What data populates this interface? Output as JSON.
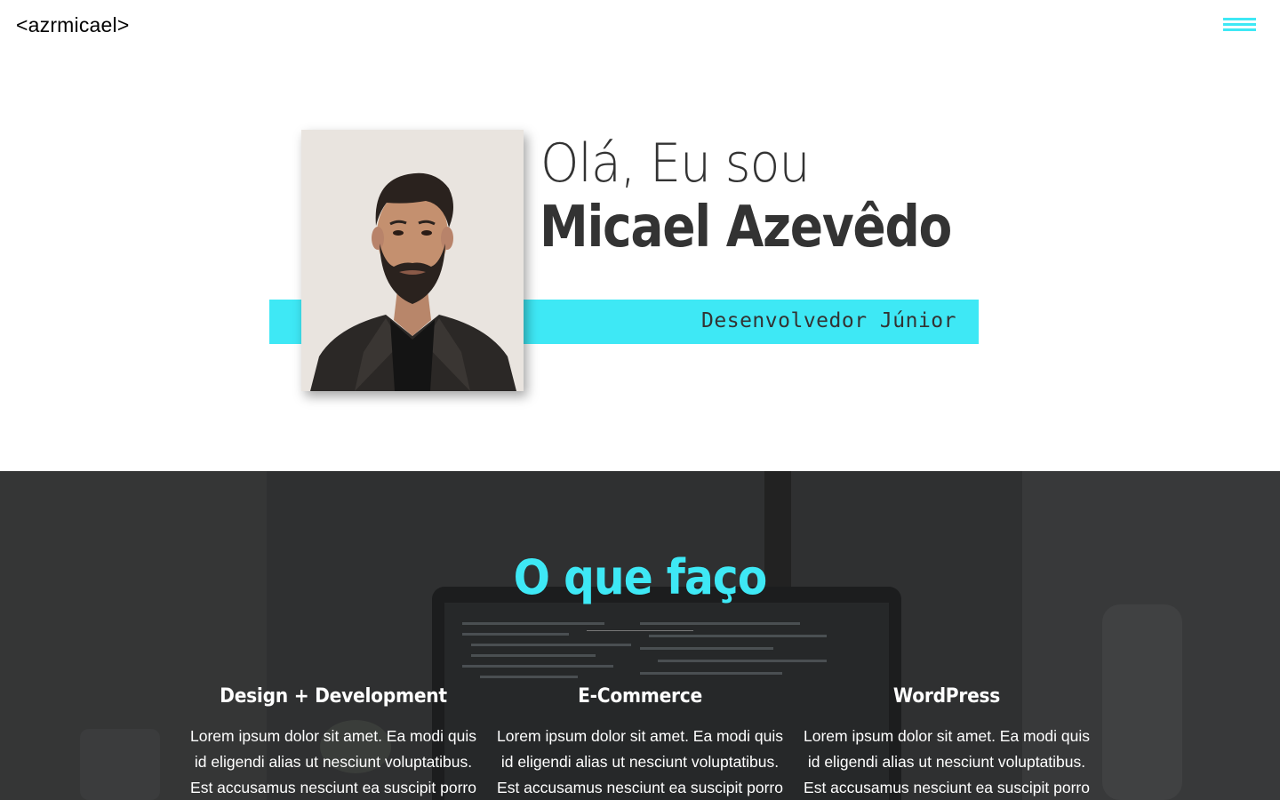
{
  "header": {
    "logo": "<azrmicael>",
    "menu_icon": "hamburger-menu-icon"
  },
  "hero": {
    "greeting": "Olá, Eu sou",
    "name": "Micael Azevêdo",
    "role": "Desenvolvedor Júnior"
  },
  "services": {
    "title": "O que faço",
    "items": [
      {
        "title": "Design + Development",
        "text": "Lorem ipsum dolor sit amet. Ea modi quis id eligendi alias ut nesciunt voluptatibus. Est accusamus nesciunt ea suscipit porro"
      },
      {
        "title": "E-Commerce",
        "text": "Lorem ipsum dolor sit amet. Ea modi quis id eligendi alias ut nesciunt voluptatibus. Est accusamus nesciunt ea suscipit porro"
      },
      {
        "title": "WordPress",
        "text": "Lorem ipsum dolor sit amet. Ea modi quis id eligendi alias ut nesciunt voluptatibus. Est accusamus nesciunt ea suscipit porro"
      }
    ]
  },
  "colors": {
    "accent": "#3ee8f5",
    "text_dark": "#333333",
    "section_bg": "#2e2f30"
  }
}
